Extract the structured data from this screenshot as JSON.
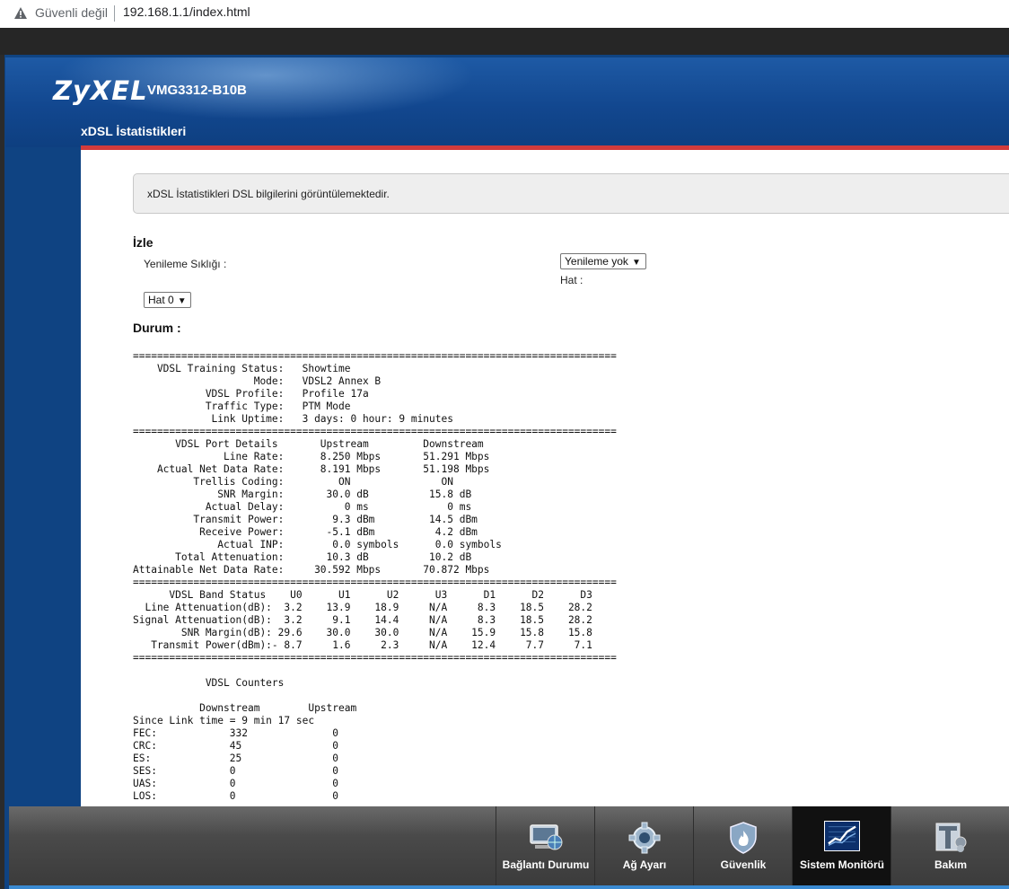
{
  "browser": {
    "insecure_label": "Güvenli değil",
    "url": "192.168.1.1/index.html"
  },
  "header": {
    "brand": "ZyXEL",
    "model": "VMG3312-B10B",
    "page_title": "xDSL İstatistikleri"
  },
  "info": {
    "text": "xDSL İstatistikleri DSL bilgilerini görüntülemektedir."
  },
  "monitor": {
    "heading": "İzle",
    "refresh_label": "Yenileme Sıklığı :",
    "refresh_value": "Yenileme yok",
    "line_label": "Hat :",
    "line_value": "Hat 0"
  },
  "status": {
    "heading": "Durum :",
    "text": "================================================================================\n    VDSL Training Status:   Showtime\n                    Mode:   VDSL2 Annex B\n            VDSL Profile:   Profile 17a\n            Traffic Type:   PTM Mode\n             Link Uptime:   3 days: 0 hour: 9 minutes\n================================================================================\n       VDSL Port Details       Upstream         Downstream\n               Line Rate:      8.250 Mbps       51.291 Mbps\n    Actual Net Data Rate:      8.191 Mbps       51.198 Mbps\n          Trellis Coding:         ON               ON\n              SNR Margin:       30.0 dB          15.8 dB\n            Actual Delay:          0 ms             0 ms\n          Transmit Power:        9.3 dBm         14.5 dBm\n           Receive Power:       -5.1 dBm          4.2 dBm\n              Actual INP:        0.0 symbols      0.0 symbols\n       Total Attenuation:       10.3 dB          10.2 dB\nAttainable Net Data Rate:     30.592 Mbps       70.872 Mbps\n================================================================================\n      VDSL Band Status    U0      U1      U2      U3      D1      D2      D3\n  Line Attenuation(dB):  3.2    13.9    18.9     N/A     8.3    18.5    28.2\nSignal Attenuation(dB):  3.2     9.1    14.4     N/A     8.3    18.5    28.2\n        SNR Margin(dB): 29.6    30.0    30.0     N/A    15.9    15.8    15.8\n   Transmit Power(dBm):- 8.7     1.6     2.3     N/A    12.4     7.7     7.1\n================================================================================\n\n            VDSL Counters\n\n           Downstream        Upstream\nSince Link time = 9 min 17 sec\nFEC:            332              0\nCRC:            45               0\nES:             25               0\nSES:            0                0\nUAS:            0                0\nLOS:            0                0"
  },
  "nav": {
    "items": [
      {
        "label": "Bağlantı Durumu",
        "icon": "monitor-globe-icon"
      },
      {
        "label": "Ağ Ayarı",
        "icon": "gear-icon"
      },
      {
        "label": "Güvenlik",
        "icon": "shield-fire-icon"
      },
      {
        "label": "Sistem Monitörü",
        "icon": "chart-icon"
      },
      {
        "label": "Bakım",
        "icon": "tools-icon"
      }
    ],
    "active_index": 3
  }
}
